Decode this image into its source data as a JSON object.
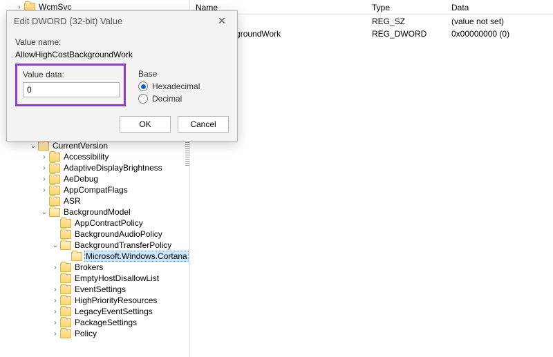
{
  "dialog": {
    "title": "Edit DWORD (32-bit) Value",
    "value_name_label": "Value name:",
    "value_name": "AllowHighCostBackgroundWork",
    "value_data_label": "Value data:",
    "value_data": "0",
    "base_label": "Base",
    "base_hex": "Hexadecimal",
    "base_dec": "Decimal",
    "ok": "OK",
    "cancel": "Cancel"
  },
  "list": {
    "headers": {
      "name": "Name",
      "type": "Type",
      "data": "Data"
    },
    "rows": [
      {
        "name": "",
        "type": "REG_SZ",
        "data": "(value not set)"
      },
      {
        "name": "hCostBackgroundWork",
        "type": "REG_DWORD",
        "data": "0x00000000 (0)"
      }
    ]
  },
  "tree_top": "WcmSvc",
  "tree": {
    "cv": "CurrentVersion",
    "items": [
      "Accessibility",
      "AdaptiveDisplayBrightness",
      "AeDebug",
      "AppCompatFlags",
      "ASR"
    ],
    "bg": "BackgroundModel",
    "bg_items": [
      "AppContractPolicy",
      "BackgroundAudioPolicy"
    ],
    "btp": "BackgroundTransferPolicy",
    "btp_sel": "Microsoft.Windows.Cortana",
    "after": [
      "Brokers",
      "EmptyHostDisallowList",
      "EventSettings",
      "HighPriorityResources",
      "LegacyEventSettings",
      "PackageSettings",
      "Policy"
    ]
  }
}
